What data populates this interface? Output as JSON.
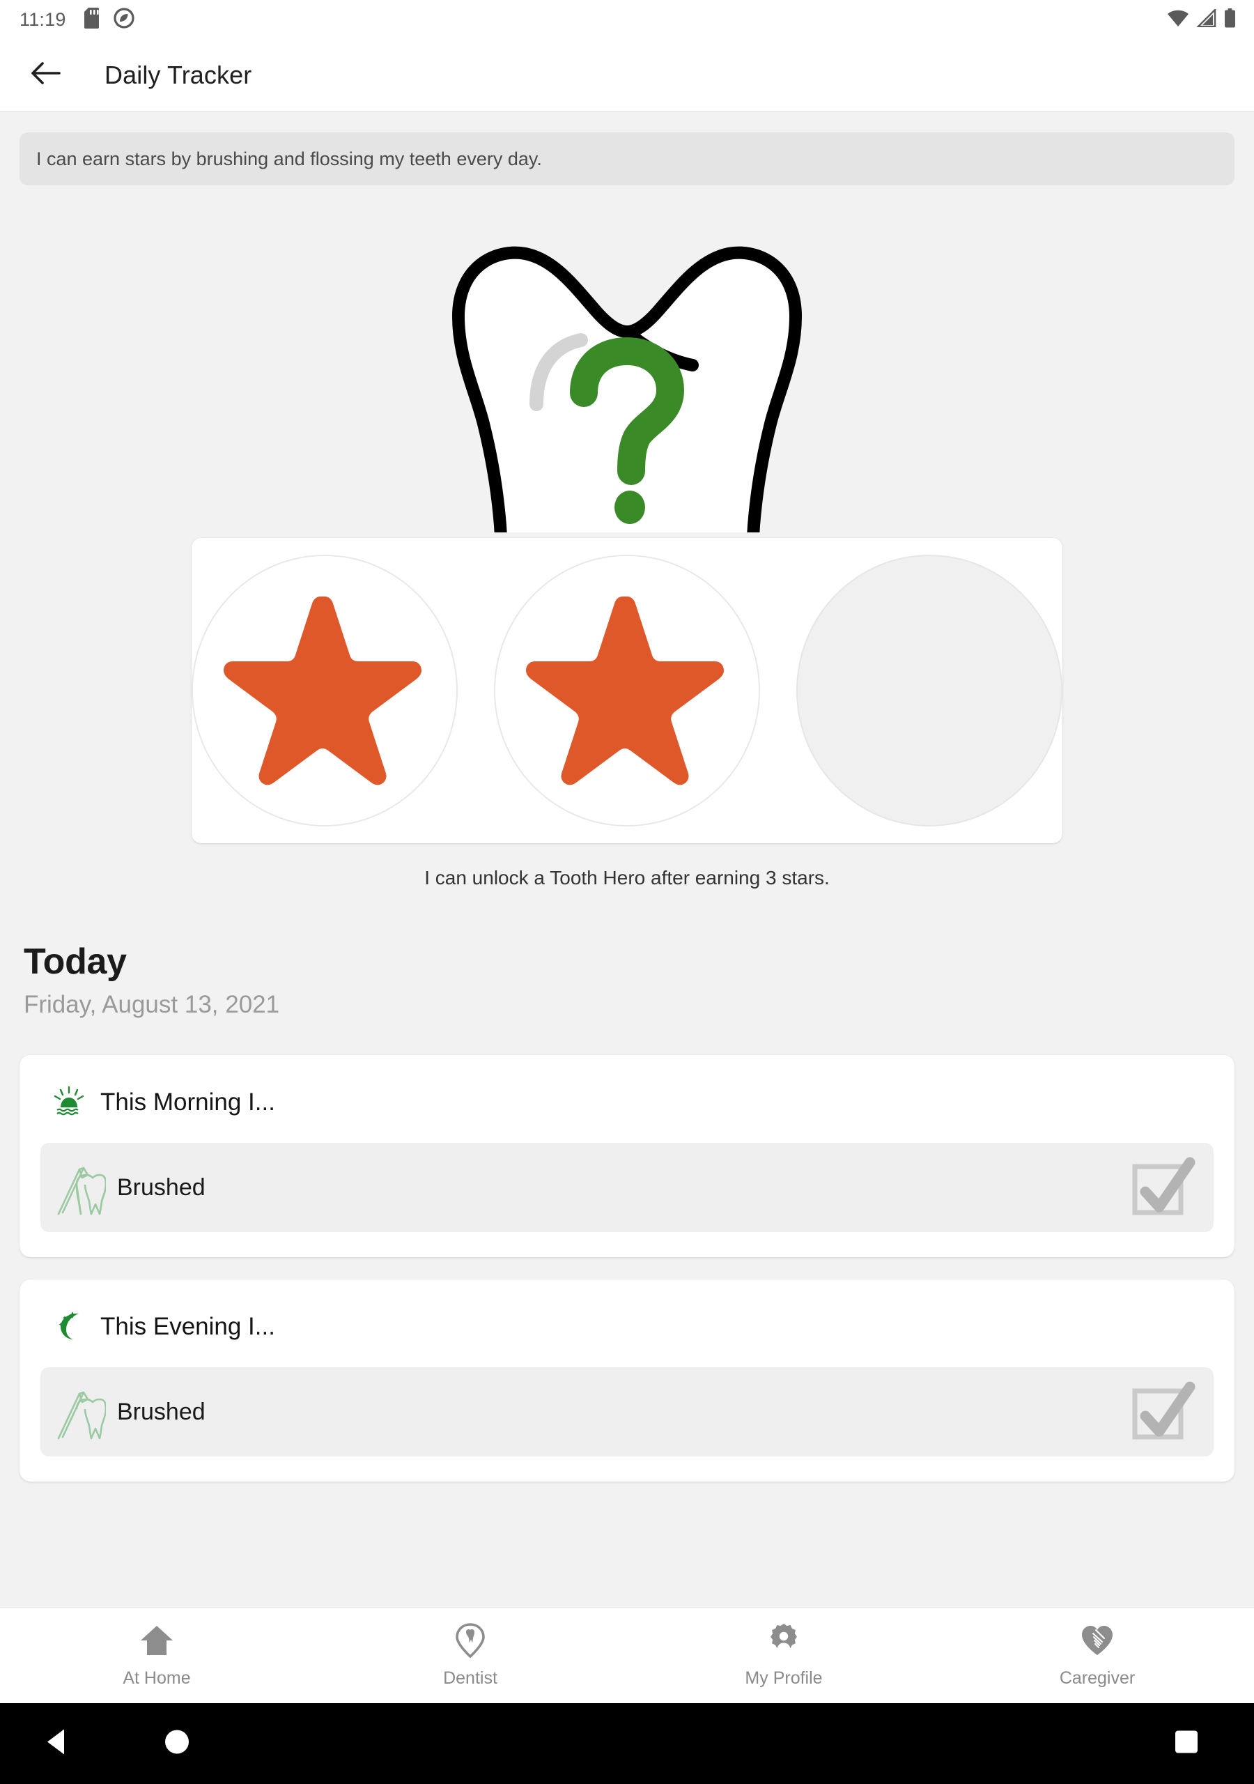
{
  "statusbar": {
    "time": "11:19",
    "icons": [
      "sd-card-icon",
      "do-not-disturb-icon",
      "wifi-icon",
      "cell-signal-icon",
      "battery-icon"
    ]
  },
  "appbar": {
    "back_icon": "back-arrow-icon",
    "title": "Daily Tracker"
  },
  "banner": {
    "text": "I can earn stars by brushing and flossing my teeth every day."
  },
  "hero": {
    "icon": "tooth-question-mark-icon",
    "outline_color": "#000000",
    "fill_color": "#ffffff",
    "highlight_color": "#d4d4d4",
    "question_color": "#3a8a28"
  },
  "stars": {
    "earned": 2,
    "total": 3,
    "star_color": "#de5829",
    "empty_color": "#f0f0f0",
    "slots": [
      {
        "state": "earned",
        "name": "star-slot-1"
      },
      {
        "state": "earned",
        "name": "star-slot-2"
      },
      {
        "state": "empty",
        "name": "star-slot-3"
      }
    ],
    "caption": "I can unlock a Tooth Hero after earning 3 stars."
  },
  "today": {
    "heading": "Today",
    "date": "Friday, August 13, 2021"
  },
  "sessions": [
    {
      "icon": "sunrise-icon",
      "title": "This Morning I...",
      "tasks": [
        {
          "icon": "toothbrush-tooth-icon",
          "label": "Brushed",
          "checked": true,
          "check_icon": "checkbox-checked-icon"
        }
      ]
    },
    {
      "icon": "crescent-moon-icon",
      "title": "This Evening I...",
      "tasks": [
        {
          "icon": "toothbrush-tooth-icon",
          "label": "Brushed",
          "checked": true,
          "check_icon": "checkbox-checked-icon"
        }
      ]
    }
  ],
  "bottomnav": {
    "items": [
      {
        "icon": "home-icon",
        "label": "At Home"
      },
      {
        "icon": "dentist-pin-icon",
        "label": "Dentist"
      },
      {
        "icon": "profile-badge-icon",
        "label": "My Profile"
      },
      {
        "icon": "caregiver-heart-hand-icon",
        "label": "Caregiver"
      }
    ]
  },
  "sysbar": {
    "back": "system-back-icon",
    "home": "system-home-icon",
    "recents": "system-recents-icon"
  },
  "colors": {
    "background": "#f2f2f2",
    "card": "#ffffff",
    "accent_green": "#1e8a32",
    "accent_orange": "#de5829",
    "muted_text": "#9a9a9a"
  }
}
